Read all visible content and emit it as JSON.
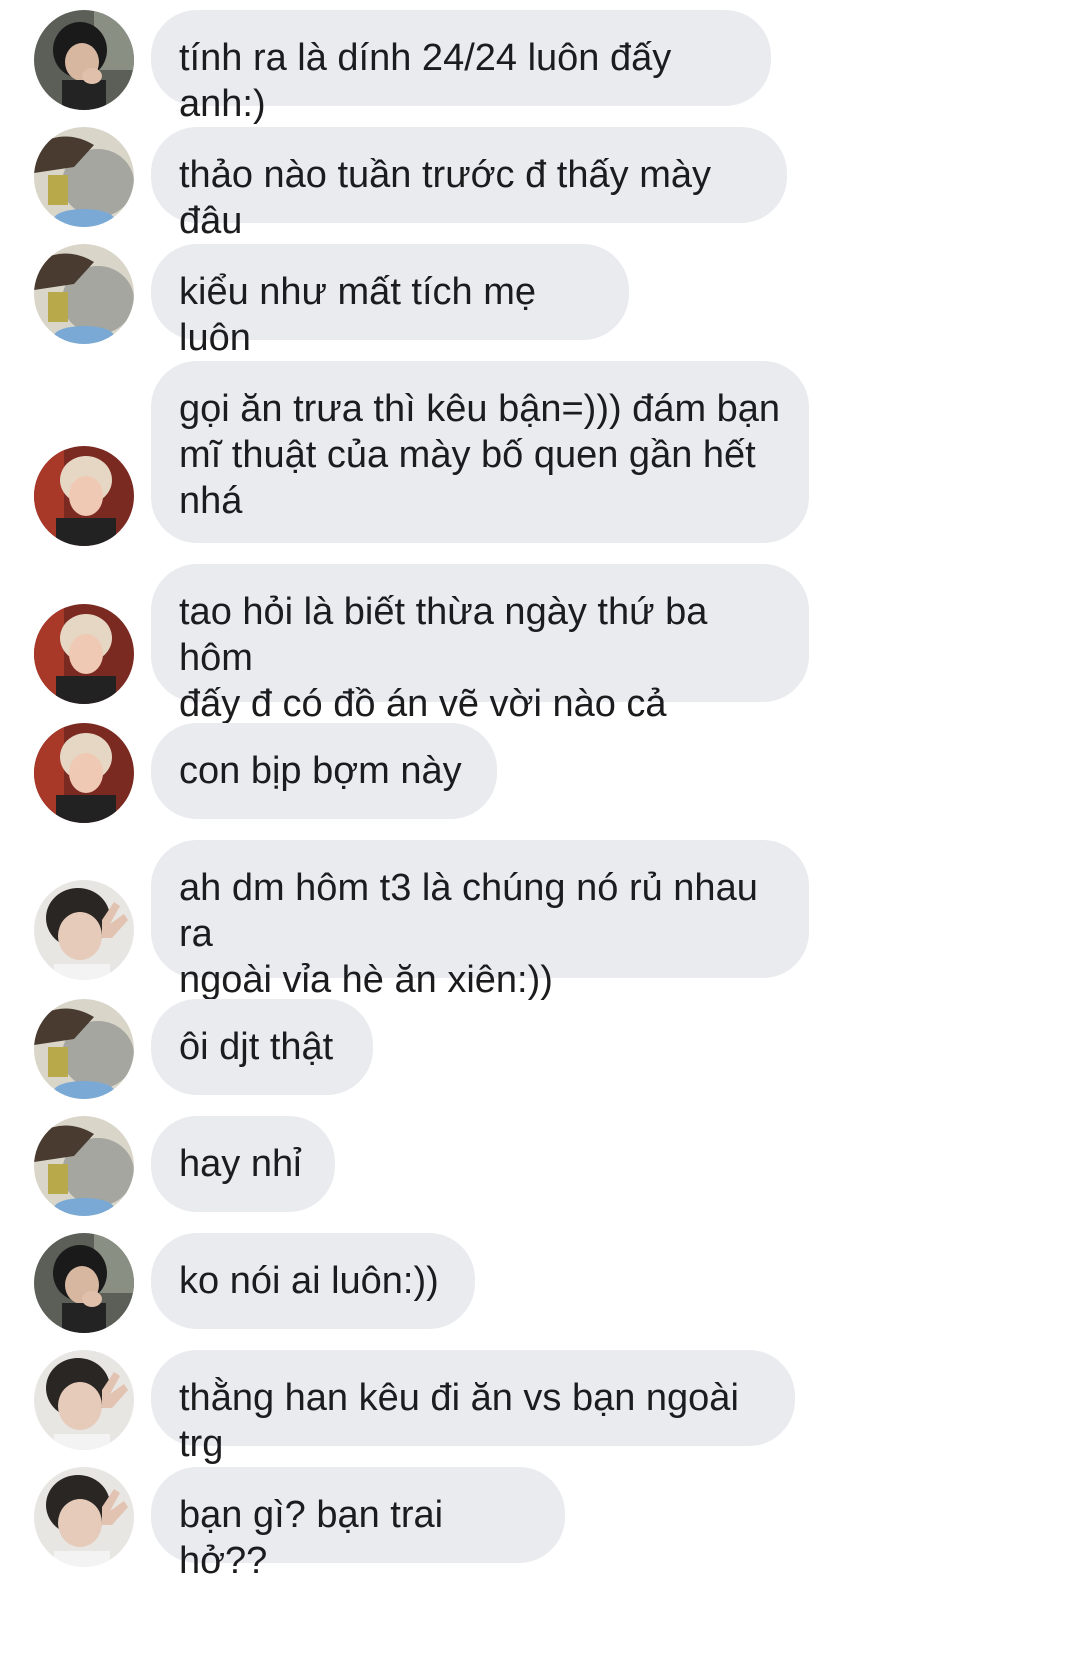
{
  "conversation": {
    "messages": [
      {
        "sender": "a",
        "text": "tính ra là dính 24/24 luôn đấy anh:)"
      },
      {
        "sender": "b",
        "text": "thảo nào tuần trước đ thấy mày đâu"
      },
      {
        "sender": "b",
        "text": "kiểu như mất tích mẹ luôn"
      },
      {
        "sender": "c",
        "text": "gọi ăn trưa thì kêu bận=))) đám bạn\nmĩ thuật của mày bố quen gần hết\nnhá"
      },
      {
        "sender": "c",
        "text": "tao hỏi là biết thừa ngày thứ ba hôm\nđấy đ có đồ án vẽ vời nào cả"
      },
      {
        "sender": "c",
        "text": "con bịp bợm này"
      },
      {
        "sender": "d",
        "text": "ah dm hôm t3 là chúng nó rủ nhau ra\nngoài vỉa hè ăn xiên:))"
      },
      {
        "sender": "b",
        "text": "ôi djt thật"
      },
      {
        "sender": "b",
        "text": "hay nhỉ"
      },
      {
        "sender": "a",
        "text": "ko nói ai luôn:))"
      },
      {
        "sender": "d",
        "text": "thằng han kêu đi ăn vs bạn ngoài trg"
      },
      {
        "sender": "d",
        "text": "bạn gì? bạn trai hở??"
      }
    ]
  },
  "avatars": {
    "a": {
      "icon": "avatar-dark-hair-icon"
    },
    "b": {
      "icon": "avatar-pillow-icon"
    },
    "c": {
      "icon": "avatar-blonde-icon"
    },
    "d": {
      "icon": "avatar-peace-sign-icon"
    }
  },
  "colors": {
    "bubble_bg": "#e9ebef",
    "text": "#1c1c1e",
    "background": "#ffffff"
  }
}
